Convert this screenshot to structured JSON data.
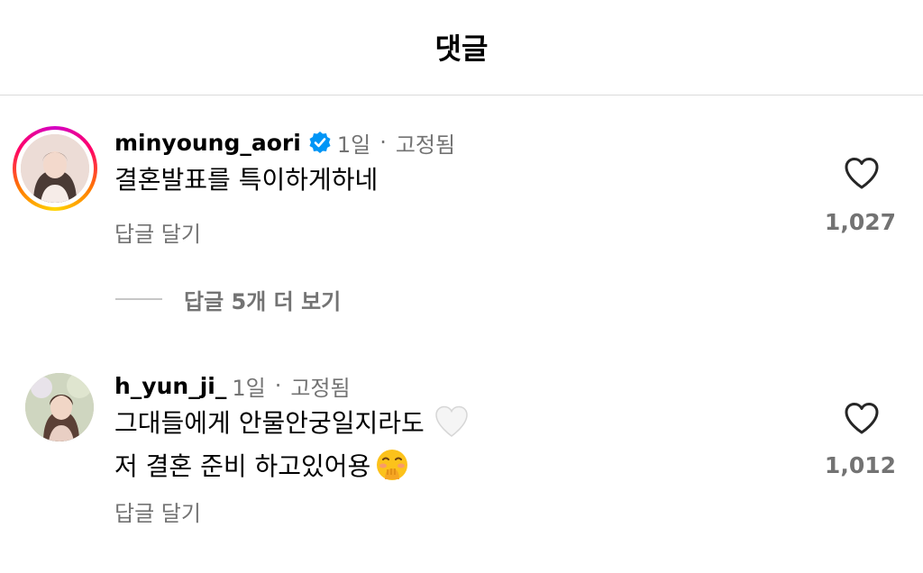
{
  "header": {
    "title": "댓글"
  },
  "comments": [
    {
      "username": "minyoung_aori",
      "verified": true,
      "time": "1일",
      "separator": "·",
      "pinned": "고정됨",
      "lines": [
        "결혼발표를 특이하게하네"
      ],
      "reply_label": "답글 달기",
      "likes": "1,027",
      "avatar_icon": "profile-photo",
      "avatar_ring": true
    },
    {
      "username": "h_yun_ji_",
      "verified": false,
      "time": "1일",
      "separator": "·",
      "pinned": "고정됨",
      "lines": [
        "그대들에게 안물안궁일지라도",
        "저 결혼 준비 하고있어용"
      ],
      "line_emojis": [
        "white-heart-emoji",
        "hand-over-mouth-emoji"
      ],
      "reply_label": "답글 달기",
      "likes": "1,012",
      "avatar_icon": "profile-photo",
      "avatar_ring": false
    }
  ],
  "view_replies": {
    "label": "답글 5개 더 보기"
  },
  "colors": {
    "secondary_text": "#737373",
    "verified_blue": "#0095f6",
    "divider": "#dbdbdb"
  }
}
